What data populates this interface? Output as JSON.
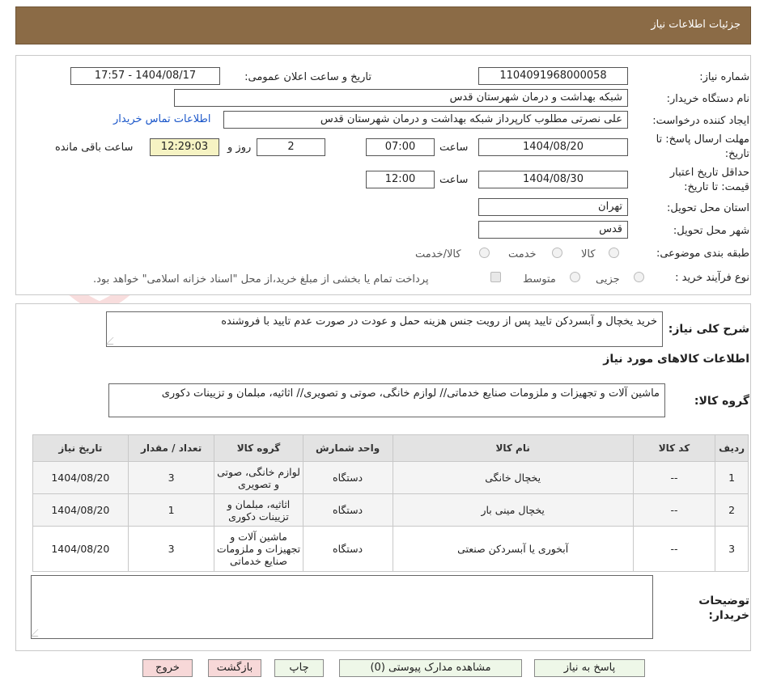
{
  "header": {
    "title": "جزئیات اطلاعات نیاز"
  },
  "form": {
    "need_number_label": "شماره نیاز:",
    "need_number": "1104091968000058",
    "announce_label": "تاریخ و ساعت اعلان عمومی:",
    "announce_value": "1404/08/17 - 17:57",
    "buyer_org_label": "نام دستگاه خریدار:",
    "buyer_org": "شبکه بهداشت و درمان شهرستان قدس",
    "requester_label": "ایجاد کننده درخواست:",
    "requester": "علی نصرتی مطلوب کارپرداز شبکه بهداشت و درمان شهرستان قدس",
    "contact_link": "اطلاعات تماس خریدار",
    "deadline_label_line1": "مهلت ارسال پاسخ: تا",
    "deadline_label_line2": "تاریخ:",
    "deadline_date": "1404/08/20",
    "time_label": "ساعت",
    "deadline_time": "07:00",
    "days_value": "2",
    "days_label": "روز و",
    "remaining_time": "12:29:03",
    "remaining_label": "ساعت باقی مانده",
    "validity_label_line1": "حداقل تاریخ اعتبار",
    "validity_label_line2": "قیمت: تا تاریخ:",
    "validity_date": "1404/08/30",
    "validity_time": "12:00",
    "province_label": "استان محل تحویل:",
    "province": "تهران",
    "city_label": "شهر محل تحویل:",
    "city": "قدس",
    "category_label": "طبقه بندی موضوعی:",
    "category_options": [
      "کالا",
      "خدمت",
      "کالا/خدمت"
    ],
    "process_label": "نوع فرآیند خرید :",
    "process_options": [
      "جزیی",
      "متوسط"
    ],
    "payment_note": "پرداخت تمام یا بخشی از مبلغ خرید،از محل \"اسناد خزانه اسلامی\" خواهد بود."
  },
  "summary": {
    "label": "شرح کلی نیاز:",
    "text": "خرید یخچال و آبسردکن تایید پس از رویت جنس هزینه حمل و عودت در صورت عدم تایید با فروشنده",
    "goods_info_title": "اطلاعات کالاهای مورد نیاز",
    "goods_group_label": "گروه کالا:",
    "goods_group_text": "ماشین آلات و تجهیزات و ملزومات صنایع خدماتی// لوازم خانگی، صوتی و تصویری// اثاثیه، مبلمان و تزیینات دکوری"
  },
  "table": {
    "headers": [
      "ردیف",
      "کد کالا",
      "نام کالا",
      "واحد شمارش",
      "گروه کالا",
      "تعداد / مقدار",
      "تاریخ نیاز"
    ],
    "rows": [
      {
        "index": "1",
        "code": "--",
        "name": "یخچال خانگی",
        "unit": "دستگاه",
        "group": "لوازم خانگی، صوتی و تصویری",
        "qty": "3",
        "date": "1404/08/20"
      },
      {
        "index": "2",
        "code": "--",
        "name": "یخچال مینی بار",
        "unit": "دستگاه",
        "group": "اثاثیه، مبلمان و تزیینات دکوری",
        "qty": "1",
        "date": "1404/08/20"
      },
      {
        "index": "3",
        "code": "--",
        "name": "آبخوری یا آبسردکن صنعتی",
        "unit": "دستگاه",
        "group": "ماشین آلات و تجهیزات و ملزومات صنایع خدماتی",
        "qty": "3",
        "date": "1404/08/20"
      }
    ]
  },
  "buyer_notes": {
    "label_line1": "توضیحات",
    "label_line2": "خریدار:",
    "text": ""
  },
  "buttons": {
    "reply": "پاسخ به نیاز",
    "attachments": "مشاهده مدارک پیوستی (0)",
    "print": "چاپ",
    "back": "بازگشت",
    "exit": "خروج"
  },
  "watermark": {
    "text": "AriaTender.neT"
  },
  "colors": {
    "header_bg": "#8b6b46",
    "link": "#1a56c9",
    "highlight": "#f6f3c3"
  }
}
